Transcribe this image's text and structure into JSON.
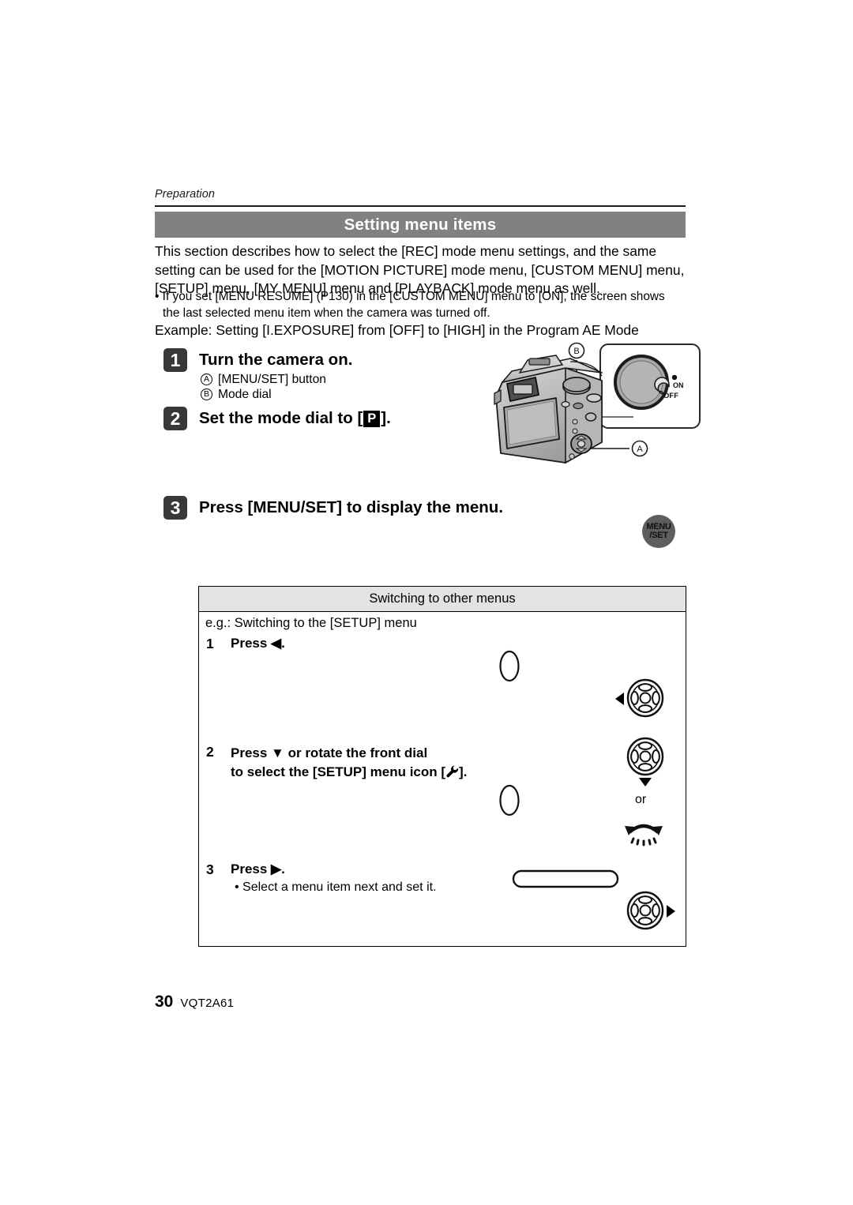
{
  "document": {
    "running_head": "Preparation",
    "section_title": "Setting menu items",
    "footer": {
      "page_number": "30",
      "doc_code": "VQT2A61"
    }
  },
  "intro": {
    "paragraph": "This section describes how to select the [REC] mode menu settings, and the same setting can be used for the [MOTION PICTURE] mode menu, [CUSTOM MENU] menu, [SETUP] menu, [MY MENU] menu and [PLAYBACK] mode menu as well.",
    "note_line1": "• If you set [MENU RESUME] (P130) in the [CUSTOM MENU] menu to [ON], the screen shows",
    "note_line2": "the last selected menu item when the camera was turned off.",
    "example": "Example: Setting [I.EXPOSURE] from [OFF] to [HIGH] in the Program AE Mode"
  },
  "steps": [
    {
      "number": "1",
      "title": "Turn the camera on.",
      "callouts": [
        {
          "letter": "A",
          "label": "[MENU/SET] button"
        },
        {
          "letter": "B",
          "label": "Mode dial"
        }
      ]
    },
    {
      "number": "2",
      "title_before": "Set the mode dial to [",
      "mode_icon": "P",
      "title_after": "]."
    },
    {
      "number": "3",
      "title": "Press [MENU/SET] to display the menu."
    }
  ],
  "camera_illustration": {
    "callout_a": "A",
    "callout_b": "B",
    "switch_on": "ON",
    "switch_off": "OFF"
  },
  "menuset_button": {
    "line1": "MENU",
    "line2": "/SET"
  },
  "switching_box": {
    "header": "Switching to other menus",
    "eg_line": "e.g.: Switching to the [SETUP] menu",
    "substeps": [
      {
        "number": "1",
        "text": "Press ◀."
      },
      {
        "number": "2",
        "line1": "Press ▼ or rotate the front dial",
        "line2_before": "to select the [SETUP] menu icon [",
        "line2_icon": "wrench-icon",
        "line2_after": "]."
      },
      {
        "number": "3",
        "text": "Press ▶.",
        "note": "• Select a menu item next and set it."
      }
    ],
    "or_label": "or"
  },
  "colors": {
    "title_bar_bg": "#818181",
    "title_bar_text": "#ffffff",
    "step_badge_bg": "#383838",
    "box_header_bg": "#e3e3e3",
    "menuset_bg": "#5e5e5e",
    "rule": "#1b1b1b"
  }
}
